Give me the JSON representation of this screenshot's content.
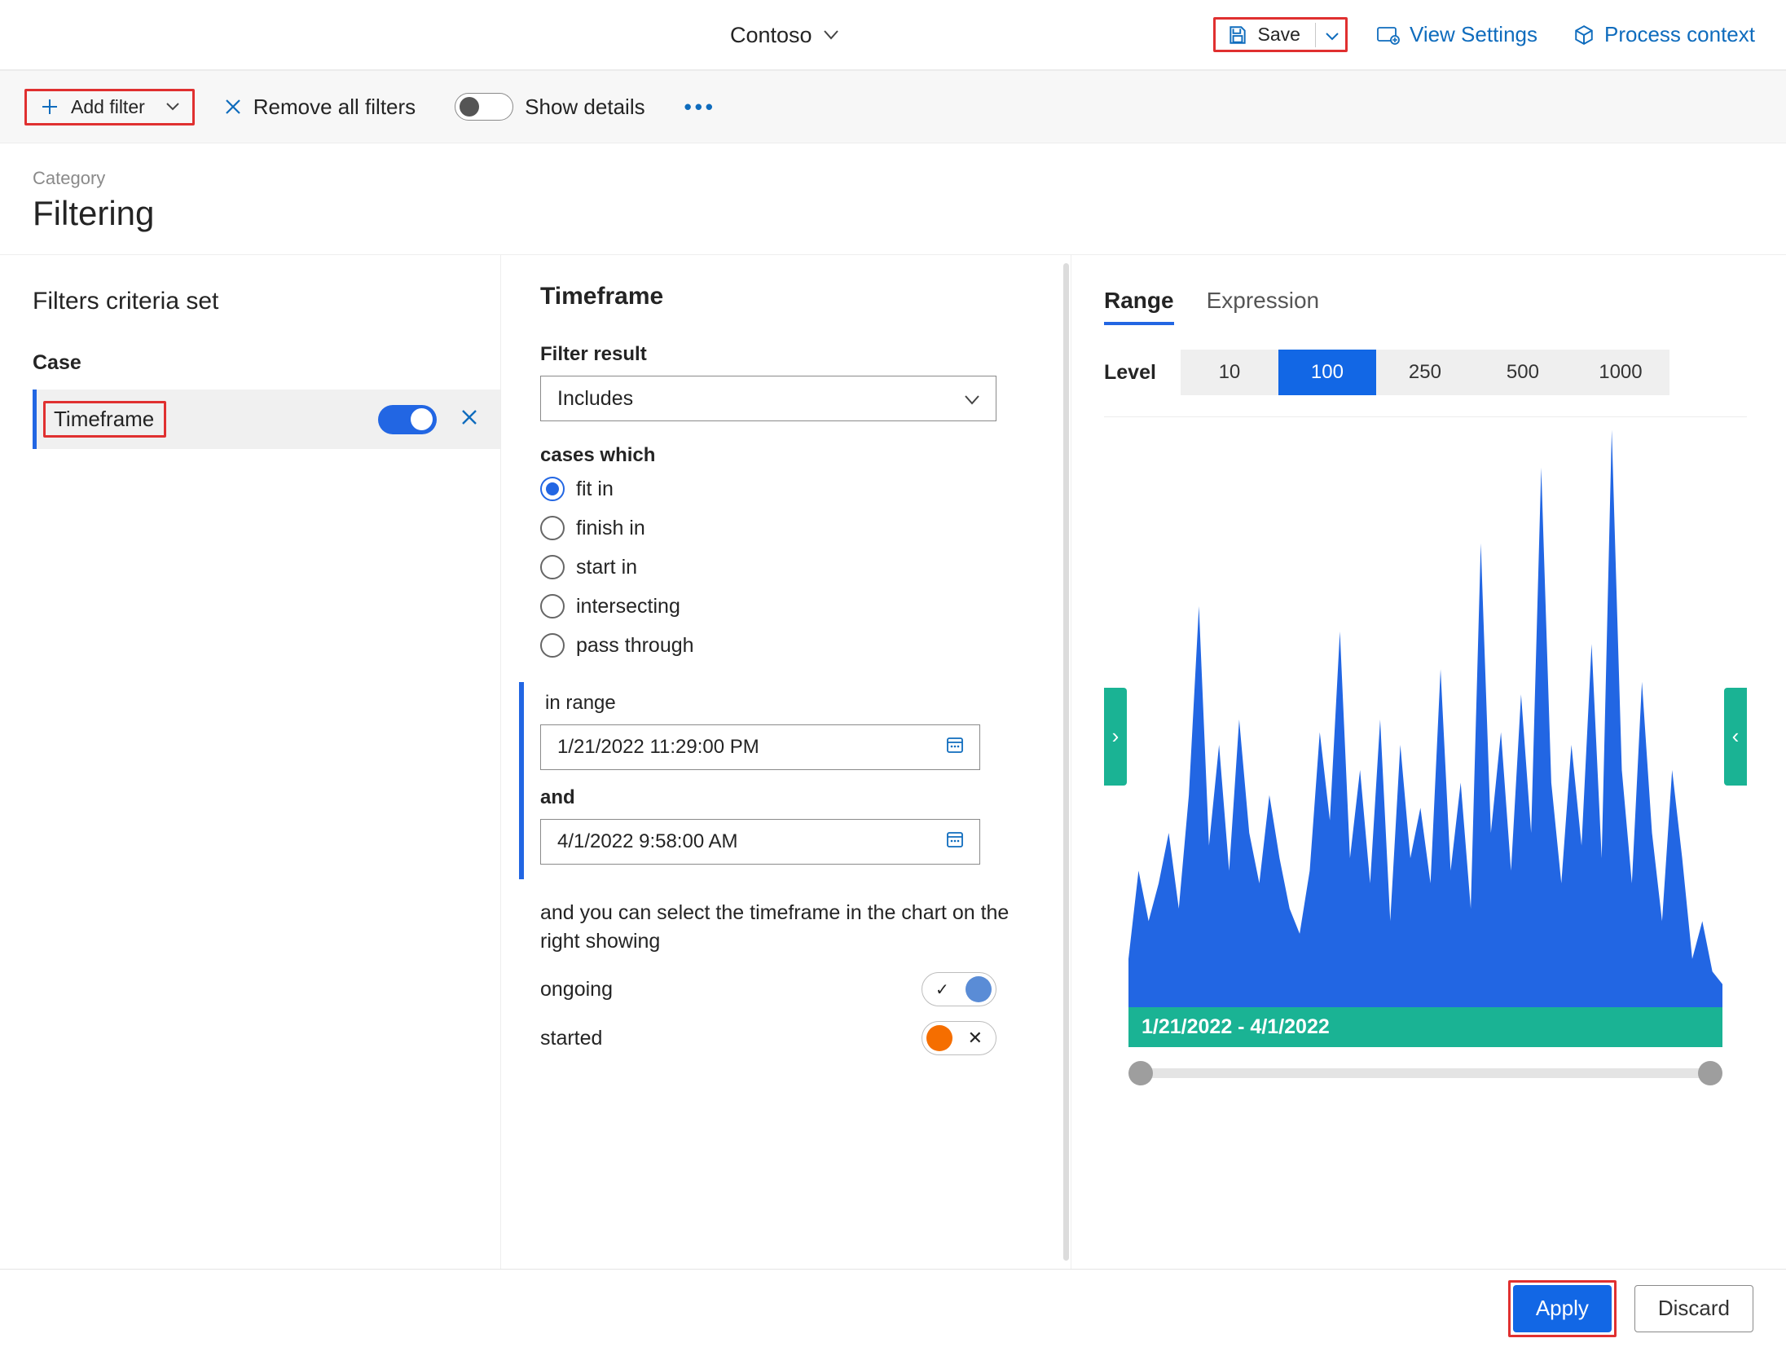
{
  "header": {
    "org": "Contoso",
    "save_label": "Save",
    "view_settings_label": "View Settings",
    "process_context_label": "Process context"
  },
  "toolbar": {
    "add_filter": "Add filter",
    "remove_all": "Remove all filters",
    "show_details": "Show details"
  },
  "category": {
    "label": "Category",
    "title": "Filtering"
  },
  "left": {
    "title": "Filters criteria set",
    "group": "Case",
    "items": [
      {
        "name": "Timeframe",
        "on": true
      }
    ]
  },
  "mid": {
    "title": "Timeframe",
    "filter_result_label": "Filter result",
    "filter_result_value": "Includes",
    "cases_label": "cases which",
    "case_options": [
      "fit in",
      "finish in",
      "start in",
      "intersecting",
      "pass through"
    ],
    "case_selected": "fit in",
    "in_range_label": "in range",
    "range_from": "1/21/2022 11:29:00 PM",
    "and_label": "and",
    "range_to": "4/1/2022 9:58:00 AM",
    "help_text": "and you can select the timeframe in the chart on the right showing",
    "legend": {
      "ongoing": "ongoing",
      "started": "started"
    }
  },
  "right": {
    "tabs": [
      "Range",
      "Expression"
    ],
    "tab_selected": "Range",
    "level_label": "Level",
    "levels": [
      "10",
      "100",
      "250",
      "500",
      "1000"
    ],
    "level_selected": "100",
    "chart_footer": "1/21/2022 - 4/1/2022"
  },
  "actions": {
    "apply": "Apply",
    "discard": "Discard"
  },
  "chart_data": {
    "type": "area",
    "title": "",
    "xlabel": "1/21/2022 - 4/1/2022",
    "ylabel": "",
    "ylim": [
      0,
      100
    ],
    "x": [
      0,
      1,
      2,
      3,
      4,
      5,
      6,
      7,
      8,
      9,
      10,
      11,
      12,
      13,
      14,
      15,
      16,
      17,
      18,
      19,
      20,
      21,
      22,
      23,
      24,
      25,
      26,
      27,
      28,
      29,
      30,
      31,
      32,
      33,
      34,
      35,
      36,
      37,
      38,
      39,
      40,
      41,
      42,
      43,
      44,
      45,
      46,
      47,
      48,
      49,
      50,
      51,
      52,
      53,
      54,
      55,
      56,
      57,
      58,
      59
    ],
    "values": [
      14,
      28,
      20,
      26,
      34,
      22,
      40,
      70,
      32,
      48,
      28,
      52,
      34,
      26,
      40,
      30,
      22,
      18,
      28,
      50,
      36,
      66,
      30,
      44,
      26,
      52,
      20,
      48,
      30,
      38,
      26,
      60,
      28,
      42,
      22,
      80,
      34,
      50,
      28,
      56,
      34,
      92,
      42,
      26,
      48,
      32,
      64,
      30,
      98,
      44,
      26,
      58,
      34,
      20,
      44,
      30,
      14,
      20,
      12,
      10
    ]
  }
}
